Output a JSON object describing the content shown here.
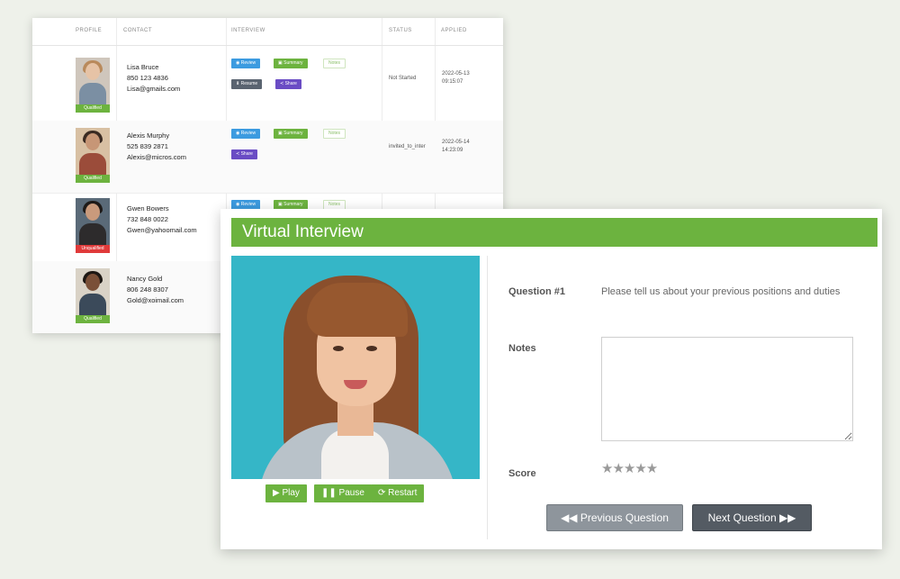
{
  "table": {
    "headers": {
      "profile": "PROFILE",
      "contact": "CONTACT",
      "interview": "INTERVIEW",
      "status": "STATUS",
      "applied": "APPLIED"
    },
    "buttons": {
      "review": "◉ Review",
      "summary": "▣ Summary",
      "notes": "Notes",
      "resume": "⬇ Resume",
      "share": "≺ Share"
    },
    "rows": [
      {
        "name": "Lisa Bruce",
        "phone": "850 123 4836",
        "email": "Lisa@gmails.com",
        "badge": "Qualified",
        "status": "Not Started",
        "applied_date": "2022-05-13",
        "applied_time": "09:15:07"
      },
      {
        "name": "Alexis Murphy",
        "phone": "525 839 2871",
        "email": "Alexis@micros.com",
        "badge": "Qualified",
        "status": "invited_to_inter",
        "applied_date": "2022-05-14",
        "applied_time": "14:23:09"
      },
      {
        "name": "Gwen Bowers",
        "phone": "732 848 0022",
        "email": "Gwen@yahoomail.com",
        "badge": "Unqualified"
      },
      {
        "name": "Nancy Gold",
        "phone": "806 248 8307",
        "email": "Gold@xoimail.com",
        "badge": "Qualified"
      }
    ]
  },
  "interview": {
    "title": "Virtual Interview",
    "controls": {
      "play": "▶ Play",
      "pause": "❚❚ Pause",
      "restart": "⟳ Restart"
    },
    "question_label": "Question #1",
    "question_text": "Please tell us about your previous positions and duties",
    "notes_label": "Notes",
    "notes_value": "",
    "score_label": "Score",
    "score_stars": "★★★★★",
    "prev_button": "◀◀ Previous Question",
    "next_button": "Next Question ▶▶"
  },
  "colors": {
    "brand_green": "#6cb33f",
    "review_blue": "#3c9be0",
    "share_purple": "#6a4cc4",
    "unqualified_red": "#e03a3a"
  }
}
